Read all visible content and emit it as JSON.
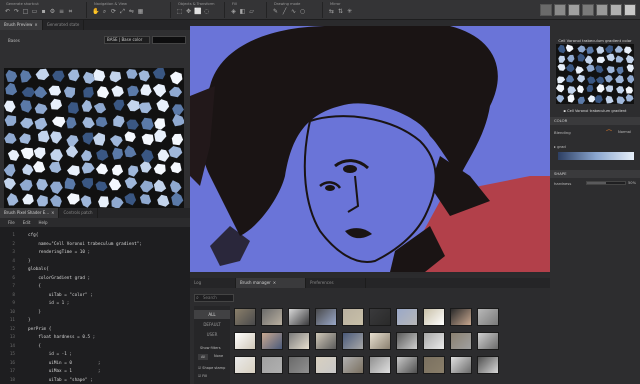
{
  "toolbar": {
    "groups": [
      {
        "label": "Generate shortcut"
      },
      {
        "label": "Navigation & View"
      },
      {
        "label": "Objects & Transform"
      },
      {
        "label": "Fill"
      },
      {
        "label": "Drawing mode"
      },
      {
        "label": "Mirror"
      }
    ]
  },
  "preview_panel": {
    "tabs": [
      "Brush Preview",
      "Generated state"
    ],
    "label_left": "Bases",
    "field_value": "BASE | Base color"
  },
  "code_panel": {
    "tabs": [
      "Brush Pixel Shader E...",
      "Controls patch"
    ],
    "menu": [
      "File",
      "Edit",
      "Help"
    ],
    "line_numbers": [
      "1",
      "2",
      "3",
      "4",
      "5",
      "6",
      "7",
      "8",
      "9",
      "10",
      "11",
      "12",
      "13",
      "14",
      "15",
      "16",
      "17",
      "18"
    ],
    "lines": [
      "cfg{",
      "    name=\"Cell Voronoi trabeculum gradient\";",
      "    renderingTime = 10 ;",
      "}",
      "globals{",
      "    colorGradient grad ;",
      "    {",
      "        uiTab = \"color\" ;",
      "        id = 1 ;",
      "    }",
      "}",
      "perPrim {",
      "    float hardness = 0.5 ;",
      "    {",
      "        id = -1 ;",
      "        uiMin = 0          ;",
      "        uiMax = 1          ;",
      "        uiTab = \"shape\" ;",
      "        uiFormat = percent ;"
    ]
  },
  "brush_manager": {
    "tabs": [
      "Log",
      "Brush manager",
      "Preferences"
    ],
    "search_placeholder": "Search",
    "categories": [
      "ALL",
      "DEFAULT",
      "USER"
    ],
    "show_label": "Show filters",
    "filter_all": "All",
    "filter_none": "None",
    "check1": "Shape stamp",
    "check2": "Fill"
  },
  "right_panel": {
    "brush_name": "Cell Voronoi trabeculum gradient color",
    "brush_name2": "Cell Voronoi trabeculum gradient",
    "section_color": "COLOR",
    "blending_label": "Blending",
    "blending_value": "Normal",
    "grad_label": "grad",
    "section_shape": "SHAPE",
    "hardness_label": "hardness",
    "hardness_value": "50%",
    "hardness_fraction": 0.5
  },
  "colors": {
    "accent": "#e07a2a",
    "canvas_bg": "#6a74d8",
    "voronoi_light": "#d6e4f7",
    "voronoi_dark": "#2d4a73"
  }
}
